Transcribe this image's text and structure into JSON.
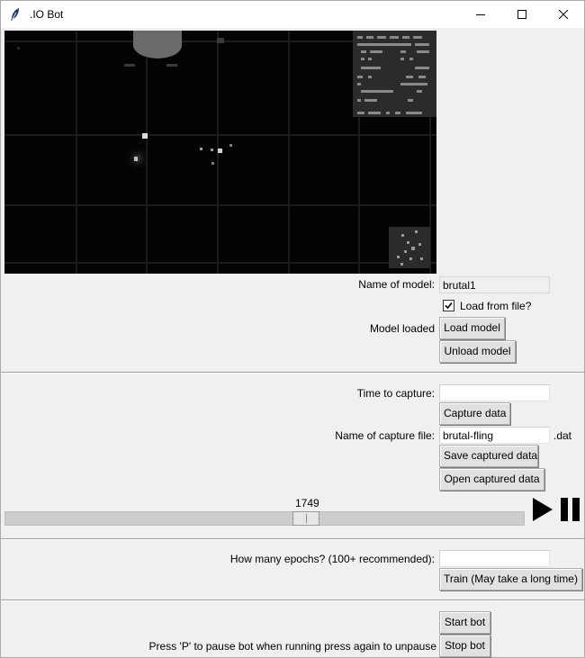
{
  "window": {
    "title": ".IO Bot",
    "icon": "feather-icon"
  },
  "model": {
    "name_label": "Name of model:",
    "name_value": "brutal1",
    "load_from_file_label": "Load from file?",
    "load_from_file_checked": true,
    "status_text": "Model loaded",
    "load_button": "Load model",
    "unload_button": "Unload model"
  },
  "capture": {
    "time_label": "Time to capture:",
    "time_value": "",
    "capture_button": "Capture data",
    "file_label": "Name of capture file:",
    "file_value": "brutal-fling",
    "file_ext": ".dat",
    "save_button": "Save captured data",
    "open_button": "Open captured data"
  },
  "playback": {
    "frame_value": "1749",
    "play_icon": "play-icon",
    "pause_icon": "pause-icon"
  },
  "training": {
    "epochs_label": "How many epochs? (100+ recommended):",
    "epochs_value": "",
    "train_button": "Train (May take a long time)"
  },
  "bot": {
    "start_button": "Start bot",
    "pause_hint": "Press 'P' to pause bot when running press again to unpause",
    "stop_button": "Stop bot"
  },
  "colors": {
    "window_bg": "#f0f0f0",
    "canvas_bg": "#030303",
    "button_bg": "#e1e1e1"
  }
}
